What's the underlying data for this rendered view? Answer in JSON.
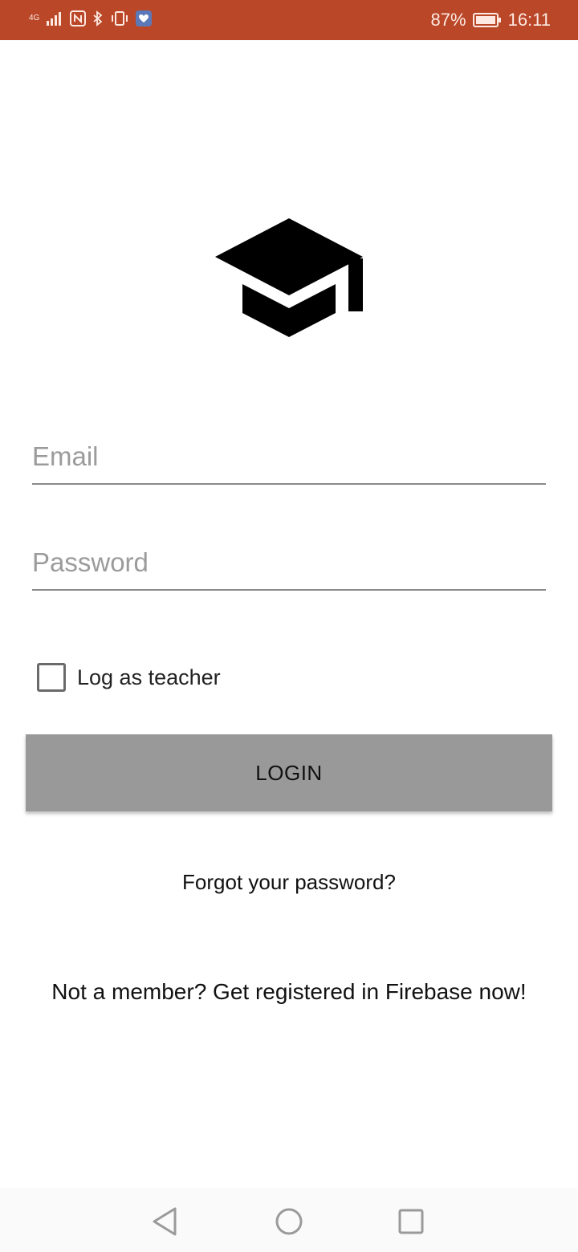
{
  "status_bar": {
    "network_label": "4G",
    "battery_percent": "87%",
    "time": "16:11",
    "icons": [
      "signal-icon",
      "nfc-icon",
      "bluetooth-icon",
      "vibrate-icon",
      "app-notification-icon",
      "battery-icon"
    ]
  },
  "logo": {
    "icon": "graduation-cap-icon"
  },
  "form": {
    "email_placeholder": "Email",
    "email_value": "",
    "password_placeholder": "Password",
    "password_value": "",
    "teacher_checkbox_label": "Log as teacher",
    "teacher_checked": false,
    "login_label": "LOGIN"
  },
  "links": {
    "forgot_password": "Forgot your password?",
    "register": "Not a member? Get registered in Firebase now!"
  },
  "nav_bar": {
    "icons": [
      "back-icon",
      "home-icon",
      "recents-icon"
    ]
  },
  "colors": {
    "status_bar": "#b94728",
    "button": "#999999",
    "placeholder": "#9b9b9b",
    "underline": "#8a8a8a"
  }
}
